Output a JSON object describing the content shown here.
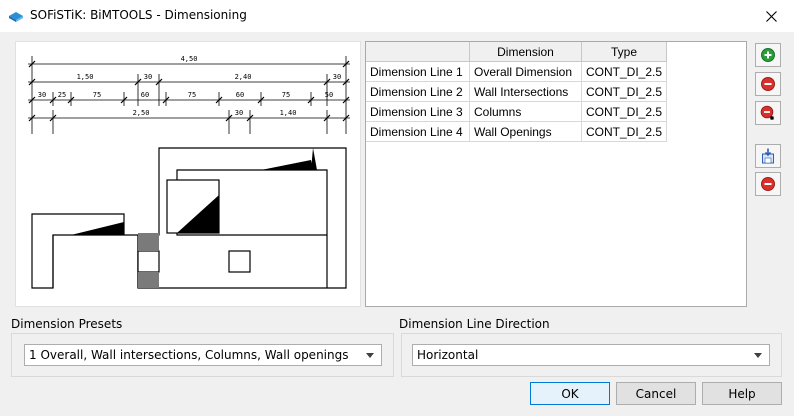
{
  "window": {
    "title": "SOFiSTiK: BiMTOOLS - Dimensioning",
    "close_icon": "close-icon"
  },
  "preview": {
    "dim_labels": {
      "overall": "4,50",
      "row2": [
        "1,50",
        "30",
        "2,40",
        "30"
      ],
      "row3": [
        "30",
        "25",
        "75",
        "60",
        "75",
        "60",
        "75",
        "50"
      ],
      "row4": [
        "2,50",
        "30",
        "1,40"
      ]
    }
  },
  "grid": {
    "columns": [
      "",
      "Dimension",
      "Type"
    ],
    "rows": [
      {
        "name": "Dimension Line 1",
        "dimension": "Overall Dimension",
        "type": "CONT_DI_2.5"
      },
      {
        "name": "Dimension Line 2",
        "dimension": "Wall Intersections",
        "type": "CONT_DI_2.5"
      },
      {
        "name": "Dimension Line 3",
        "dimension": "Columns",
        "type": "CONT_DI_2.5"
      },
      {
        "name": "Dimension Line 4",
        "dimension": "Wall Openings",
        "type": "CONT_DI_2.5"
      }
    ]
  },
  "side_buttons": [
    {
      "icon": "add-icon",
      "color": "#2a9d3b"
    },
    {
      "icon": "remove-icon",
      "color": "#d9302c"
    },
    {
      "icon": "remove-all-icon",
      "color": "#d9302c"
    },
    {
      "icon": "save-icon",
      "color": "#2f5fb3"
    },
    {
      "icon": "delete-icon",
      "color": "#d9302c"
    }
  ],
  "presets": {
    "label": "Dimension Presets",
    "value": "1 Overall, Wall intersections, Columns, Wall openings"
  },
  "direction": {
    "label": "Dimension Line Direction",
    "value": "Horizontal"
  },
  "buttons": {
    "ok": "OK",
    "cancel": "Cancel",
    "help": "Help"
  }
}
